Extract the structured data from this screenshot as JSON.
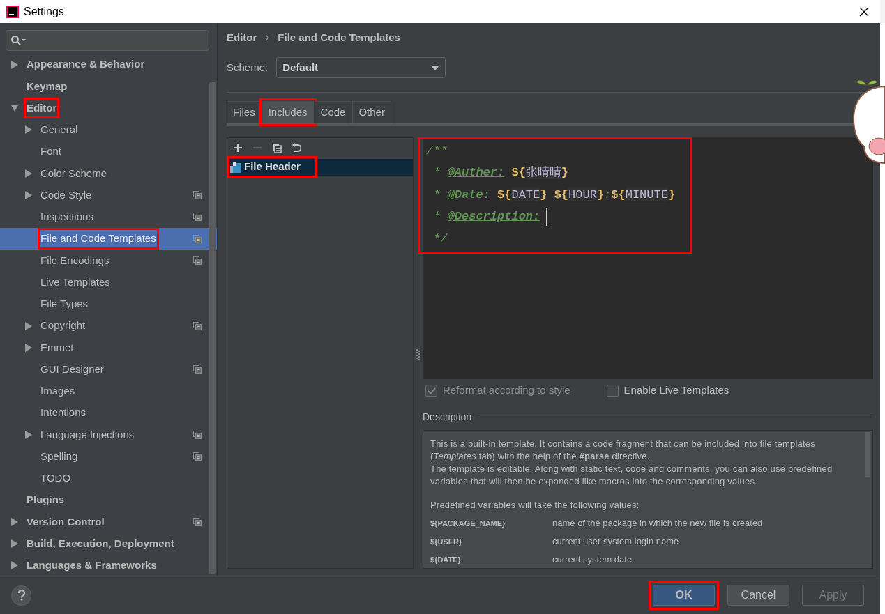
{
  "window": {
    "title": "Settings"
  },
  "sidebar": {
    "items": [
      {
        "label": "Appearance & Behavior",
        "expanded": false,
        "selected": false,
        "annotated": false,
        "project_scope": false
      },
      {
        "label": "Keymap",
        "selected": false,
        "annotated": false,
        "project_scope": false
      },
      {
        "label": "Editor",
        "expanded": true,
        "selected": false,
        "annotated": true,
        "project_scope": false,
        "children": [
          {
            "label": "General",
            "expanded": false,
            "selected": false,
            "annotated": false,
            "project_scope": false
          },
          {
            "label": "Font",
            "selected": false,
            "annotated": false,
            "project_scope": false
          },
          {
            "label": "Color Scheme",
            "expanded": false,
            "selected": false,
            "annotated": false,
            "project_scope": false
          },
          {
            "label": "Code Style",
            "expanded": false,
            "selected": false,
            "annotated": false,
            "project_scope": true
          },
          {
            "label": "Inspections",
            "selected": false,
            "annotated": false,
            "project_scope": true
          },
          {
            "label": "File and Code Templates",
            "selected": true,
            "annotated": true,
            "project_scope": true
          },
          {
            "label": "File Encodings",
            "selected": false,
            "annotated": false,
            "project_scope": true
          },
          {
            "label": "Live Templates",
            "selected": false,
            "annotated": false,
            "project_scope": false
          },
          {
            "label": "File Types",
            "selected": false,
            "annotated": false,
            "project_scope": false
          },
          {
            "label": "Copyright",
            "expanded": false,
            "selected": false,
            "annotated": false,
            "project_scope": true
          },
          {
            "label": "Emmet",
            "expanded": false,
            "selected": false,
            "annotated": false,
            "project_scope": false
          },
          {
            "label": "GUI Designer",
            "selected": false,
            "annotated": false,
            "project_scope": true
          },
          {
            "label": "Images",
            "selected": false,
            "annotated": false,
            "project_scope": false
          },
          {
            "label": "Intentions",
            "selected": false,
            "annotated": false,
            "project_scope": false
          },
          {
            "label": "Language Injections",
            "expanded": false,
            "selected": false,
            "annotated": false,
            "project_scope": true
          },
          {
            "label": "Spelling",
            "selected": false,
            "annotated": false,
            "project_scope": true
          },
          {
            "label": "TODO",
            "selected": false,
            "annotated": false,
            "project_scope": false
          }
        ]
      },
      {
        "label": "Plugins",
        "selected": false,
        "annotated": false,
        "project_scope": false
      },
      {
        "label": "Version Control",
        "expanded": false,
        "selected": false,
        "annotated": false,
        "project_scope": true
      },
      {
        "label": "Build, Execution, Deployment",
        "expanded": false,
        "selected": false,
        "annotated": false,
        "project_scope": false
      },
      {
        "label": "Languages & Frameworks",
        "expanded": false,
        "selected": false,
        "annotated": false,
        "project_scope": false
      }
    ]
  },
  "breadcrumb": [
    "Editor",
    "File and Code Templates"
  ],
  "scheme": {
    "label": "Scheme:",
    "value": "Default"
  },
  "tabs": [
    {
      "label": "Files",
      "selected": false,
      "annotated": false
    },
    {
      "label": "Includes",
      "selected": true,
      "annotated": true
    },
    {
      "label": "Code",
      "selected": false,
      "annotated": false
    },
    {
      "label": "Other",
      "selected": false,
      "annotated": false
    }
  ],
  "toolbar": [
    {
      "kind": "add",
      "disabled": false
    },
    {
      "kind": "remove",
      "disabled": true
    },
    {
      "kind": "copy",
      "disabled": false
    },
    {
      "kind": "reset",
      "disabled": false
    }
  ],
  "templates": [
    {
      "label": "File Header",
      "selected": true,
      "annotated": true
    }
  ],
  "editor": {
    "annotated": true,
    "lines": [
      {
        "caret": false,
        "segments": [
          {
            "kind": "comment",
            "text": "/**"
          }
        ]
      },
      {
        "caret": false,
        "segments": [
          {
            "kind": "comment",
            "text": " * "
          },
          {
            "kind": "tag",
            "text": "@Auther:"
          },
          {
            "kind": "brace",
            "text": " ${"
          },
          {
            "kind": "var",
            "text": "张晴晴"
          },
          {
            "kind": "brace",
            "text": "}"
          }
        ]
      },
      {
        "caret": false,
        "segments": [
          {
            "kind": "comment",
            "text": " * "
          },
          {
            "kind": "tag",
            "text": "@Date:"
          },
          {
            "kind": "brace",
            "text": " ${"
          },
          {
            "kind": "var",
            "text": "DATE"
          },
          {
            "kind": "brace",
            "text": "}"
          },
          {
            "kind": "brace",
            "text": " ${"
          },
          {
            "kind": "var",
            "text": "HOUR"
          },
          {
            "kind": "brace",
            "text": "}"
          },
          {
            "kind": "comment",
            "text": ":"
          },
          {
            "kind": "brace",
            "text": "${"
          },
          {
            "kind": "var",
            "text": "MINUTE"
          },
          {
            "kind": "brace",
            "text": "}"
          }
        ]
      },
      {
        "caret": true,
        "segments": [
          {
            "kind": "comment",
            "text": " * "
          },
          {
            "kind": "tag",
            "text": "@Description:"
          }
        ]
      },
      {
        "caret": false,
        "segments": [
          {
            "kind": "comment",
            "text": " */"
          }
        ]
      }
    ]
  },
  "options": [
    {
      "label": "Reformat according to style",
      "checked": true,
      "disabled": true
    },
    {
      "label": "Enable Live Templates",
      "checked": false,
      "disabled": false
    }
  ],
  "description": {
    "title": "Description",
    "paragraphs": [
      "This is a built-in template. It contains a code fragment that can be included into file templates (*Templates* tab) with the help of the **#parse** directive.",
      "The template is editable. Along with static text, code and comments, you can also use predefined variables that will then be expanded like macros into the corresponding values."
    ],
    "note": "Predefined variables will take the following values:",
    "variables": [
      {
        "name": "${PACKAGE_NAME}",
        "meaning": "name of the package in which the new file is created"
      },
      {
        "name": "${USER}",
        "meaning": "current user system login name"
      },
      {
        "name": "${DATE}",
        "meaning": "current system date"
      }
    ]
  },
  "buttons": [
    {
      "label": "OK",
      "kind": "primary",
      "disabled": false,
      "annotated": true
    },
    {
      "label": "Cancel",
      "kind": "default",
      "disabled": false,
      "annotated": false
    },
    {
      "label": "Apply",
      "kind": "default",
      "disabled": true,
      "annotated": false
    }
  ]
}
